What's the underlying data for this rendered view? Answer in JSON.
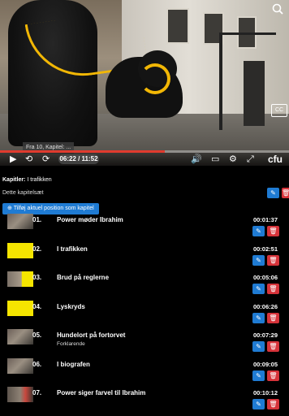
{
  "player": {
    "zoom_icon": "zoom-icon",
    "subtitles_label": "CC",
    "tooltip": "Fra 10, Kapitel: ...",
    "progress": 0.57,
    "time": "06:22 / 11:52",
    "brand": "cfu",
    "controls": {
      "play": "▶",
      "rewind": "⟲",
      "forward": "⟳",
      "volume": "🔊",
      "captions": "▭",
      "settings": "⚙",
      "fullscreen": "⤢"
    },
    "colors": {
      "progress": "#e03b2e"
    }
  },
  "chapters": {
    "header_label": "Kapitler:",
    "header_value": "I trafikken",
    "subtitle": "Dette kapitelsæt",
    "add_button": "Tilføj aktuel position som kapitel",
    "edit_symbol": "✎",
    "delete_symbol": "🗑",
    "items": [
      {
        "num": "01.",
        "title": "Power møder Ibrahim",
        "subtitle": "",
        "time": "00:01:37",
        "thumb": "scene"
      },
      {
        "num": "02.",
        "title": "I trafikken",
        "subtitle": "",
        "time": "00:02:51",
        "thumb": "yellow"
      },
      {
        "num": "03.",
        "title": "Brud på reglerne",
        "subtitle": "",
        "time": "00:05:06",
        "thumb": "scene-yellow"
      },
      {
        "num": "04.",
        "title": "Lyskryds",
        "subtitle": "",
        "time": "00:06:26",
        "thumb": "yellow"
      },
      {
        "num": "05.",
        "title": "Hundelort på fortorvet",
        "subtitle": "Forklarende",
        "time": "00:07:29",
        "thumb": "scene"
      },
      {
        "num": "06.",
        "title": "I biografen",
        "subtitle": "",
        "time": "00:09:05",
        "thumb": "scene"
      },
      {
        "num": "07.",
        "title": "Power siger farvel til Ibrahim",
        "subtitle": "",
        "time": "00:10:12",
        "thumb": "scene-red"
      }
    ],
    "colors": {
      "edit": "#1f7bd3",
      "delete": "#d6333a"
    }
  }
}
